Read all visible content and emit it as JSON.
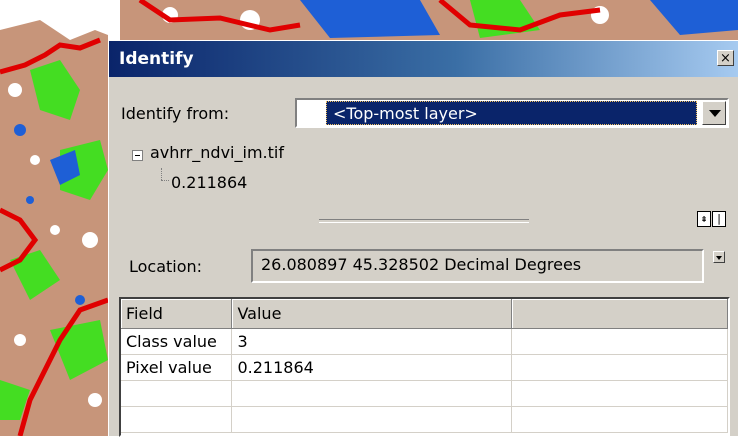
{
  "window": {
    "title": "Identify",
    "close_glyph": "×"
  },
  "identify_from": {
    "label": "Identify from:",
    "value": "<Top-most layer>"
  },
  "tree": {
    "layer": "avhrr_ndvi_im.tif",
    "value": "0.211864"
  },
  "location": {
    "label": "Location:",
    "value": "26.080897  45.328502 Decimal Degrees"
  },
  "table": {
    "columns": [
      "Field",
      "Value",
      ""
    ],
    "rows": [
      [
        "Class value",
        "3",
        ""
      ],
      [
        "Pixel value",
        "0.211864",
        ""
      ],
      [
        "",
        "",
        ""
      ],
      [
        "",
        "",
        ""
      ]
    ]
  },
  "icons": {
    "close": "close-icon",
    "combo_arrow": "chevron-down-icon",
    "tree_expander": "collapse-icon",
    "location_dropdown": "chevron-down-icon",
    "splitter_buttons": [
      "collapse-up-icon",
      "split-view-icon"
    ]
  },
  "colors": {
    "title_bar": "#0a246a",
    "selection": "#0a246a",
    "dialog_face": "#d4d0c8",
    "map_land": "#c7957a",
    "map_vegetation": "#44dd22",
    "map_water": "#1e5fd6",
    "map_boundary": "#e00000"
  }
}
